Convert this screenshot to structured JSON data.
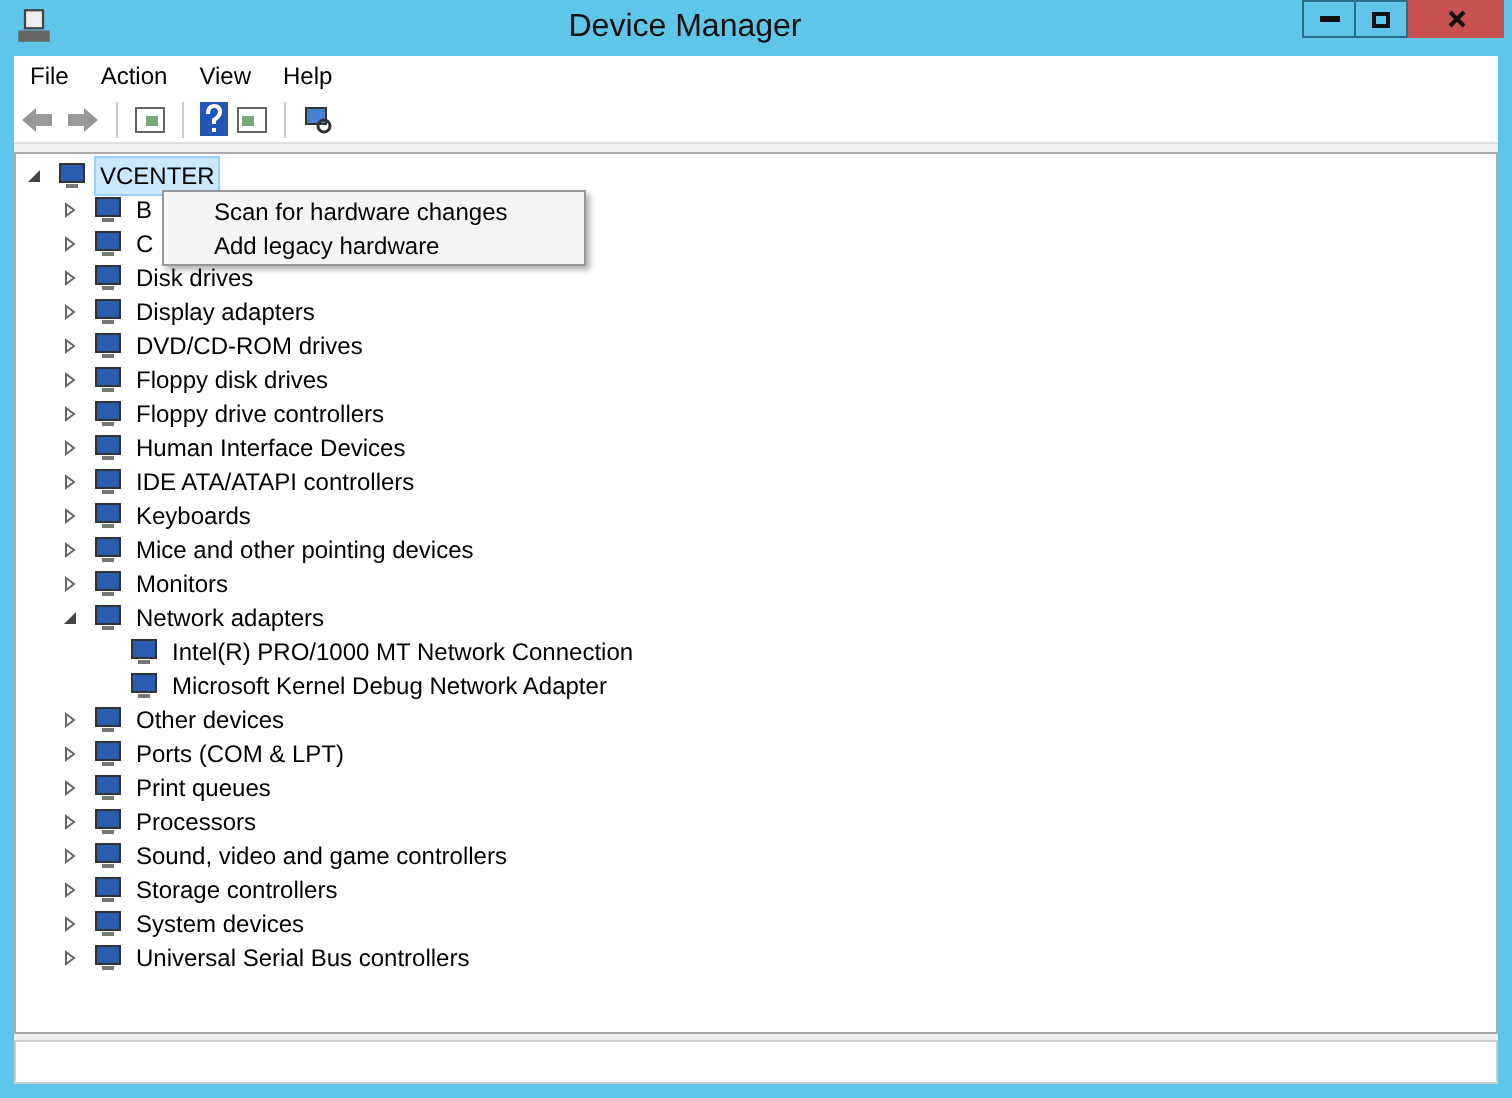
{
  "window": {
    "title": "Device Manager"
  },
  "menu": [
    "File",
    "Action",
    "View",
    "Help"
  ],
  "tree": {
    "label": "VCENTER",
    "expanded": true,
    "selected": true,
    "children": [
      {
        "label": "B",
        "expanded": false
      },
      {
        "label": "C",
        "expanded": false
      },
      {
        "label": "Disk drives",
        "expanded": false
      },
      {
        "label": "Display adapters",
        "expanded": false
      },
      {
        "label": "DVD/CD-ROM drives",
        "expanded": false
      },
      {
        "label": "Floppy disk drives",
        "expanded": false
      },
      {
        "label": "Floppy drive controllers",
        "expanded": false
      },
      {
        "label": "Human Interface Devices",
        "expanded": false
      },
      {
        "label": "IDE ATA/ATAPI controllers",
        "expanded": false
      },
      {
        "label": "Keyboards",
        "expanded": false
      },
      {
        "label": "Mice and other pointing devices",
        "expanded": false
      },
      {
        "label": "Monitors",
        "expanded": false
      },
      {
        "label": "Network adapters",
        "expanded": true,
        "children": [
          {
            "label": "Intel(R) PRO/1000 MT Network Connection"
          },
          {
            "label": "Microsoft Kernel Debug Network Adapter"
          }
        ]
      },
      {
        "label": "Other devices",
        "expanded": false
      },
      {
        "label": "Ports (COM & LPT)",
        "expanded": false
      },
      {
        "label": "Print queues",
        "expanded": false
      },
      {
        "label": "Processors",
        "expanded": false
      },
      {
        "label": "Sound, video and game controllers",
        "expanded": false
      },
      {
        "label": "Storage controllers",
        "expanded": false
      },
      {
        "label": "System devices",
        "expanded": false
      },
      {
        "label": "Universal Serial Bus controllers",
        "expanded": false
      }
    ]
  },
  "context_menu": [
    "Scan for hardware changes",
    "Add legacy hardware"
  ]
}
